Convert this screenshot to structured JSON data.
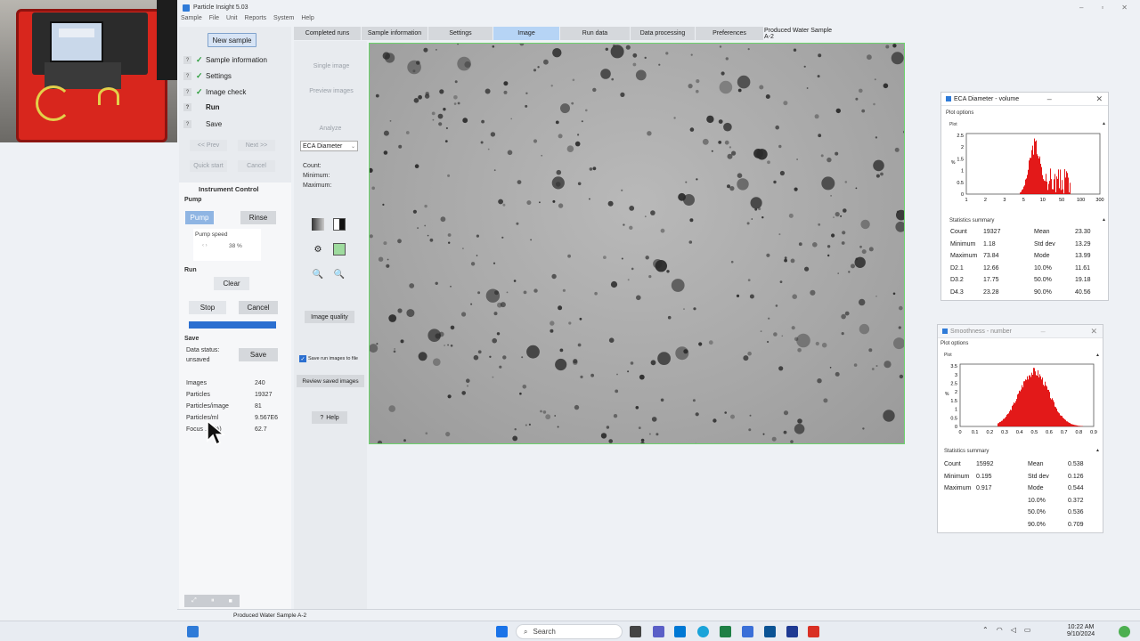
{
  "app": {
    "title": "Particle Insight   5.03",
    "menu": [
      "Sample",
      "File",
      "Unit",
      "Reports",
      "System",
      "Help"
    ],
    "tabs": [
      "Completed runs",
      "Sample information",
      "Settings",
      "Image",
      "Run data",
      "Data processing",
      "Preferences",
      "Produced Water Sample A-2"
    ],
    "active_tab": "Image"
  },
  "left": {
    "new_sample": "New sample",
    "steps": [
      {
        "label": "Sample information",
        "done": true
      },
      {
        "label": "Settings",
        "done": true
      },
      {
        "label": "Image check",
        "done": true
      },
      {
        "label": "Run",
        "done": false
      },
      {
        "label": "Save",
        "done": false
      }
    ],
    "prev": "<< Prev",
    "next": "Next >>",
    "quick_start": "Quick start",
    "cancel": "Cancel"
  },
  "instrument": {
    "title": "Instrument Control",
    "pump_section": "Pump",
    "pump_btn": "Pump",
    "rinse_btn": "Rinse",
    "pump_speed_label": "Pump speed",
    "pump_speed_value": "38 %",
    "run_section": "Run",
    "clear_btn": "Clear",
    "stop_btn": "Stop",
    "cancel_btn": "Cancel",
    "progress": 1.0,
    "save_section": "Save",
    "data_status_label": "Data status:",
    "data_status_value": "unsaved",
    "save_btn": "Save",
    "stats": [
      {
        "label": "Images",
        "value": "240"
      },
      {
        "label": "Particles",
        "value": "19327"
      },
      {
        "label": "Particles/image",
        "value": "81"
      },
      {
        "label": "Particles/ml",
        "value": "9.567E6"
      },
      {
        "label": "Focus ... (%)",
        "value": "62.7"
      }
    ]
  },
  "middle": {
    "single_image": "Single image",
    "preview_images": "Preview images",
    "analyze": "Analyze",
    "dropdown": "ECA Diameter",
    "count_label": "Count:",
    "min_label": "Minimum:",
    "max_label": "Maximum:",
    "image_quality": "Image quality",
    "save_run_images": "Save run images to file",
    "review_saved": "Review saved images",
    "help": "Help"
  },
  "plot1": {
    "title": "ECA Diameter - volume",
    "plot_options": "Plot options",
    "plot_label": "Plot",
    "stats_title": "Statistics summary",
    "rows": [
      [
        "Count",
        "19327",
        "Mean",
        "23.30"
      ],
      [
        "Minimum",
        "1.18",
        "Std dev",
        "13.29"
      ],
      [
        "Maximum",
        "73.84",
        "Mode",
        "13.99"
      ],
      [
        "D2.1",
        "12.66",
        "10.0%",
        "11.61"
      ],
      [
        "D3.2",
        "17.75",
        "50.0%",
        "19.18"
      ],
      [
        "D4.3",
        "23.28",
        "90.0%",
        "40.56"
      ]
    ],
    "chart_data": {
      "type": "bar",
      "x_ticks": [
        "1",
        "2",
        "3",
        "5",
        "10",
        "50",
        "100",
        "300"
      ],
      "y_ticks": [
        "0",
        "0.5",
        "1",
        "1.5",
        "2",
        "2.5"
      ],
      "ylabel": "%",
      "ylim": [
        0,
        2.7
      ]
    }
  },
  "plot2": {
    "title": "Smoothness - number",
    "plot_options": "Plot options",
    "plot_label": "Plot",
    "stats_title": "Statistics summary",
    "rows": [
      [
        "Count",
        "15992",
        "Mean",
        "0.538"
      ],
      [
        "Minimum",
        "0.195",
        "Std dev",
        "0.126"
      ],
      [
        "Maximum",
        "0.917",
        "Mode",
        "0.544"
      ],
      [
        "",
        "",
        "10.0%",
        "0.372"
      ],
      [
        "",
        "",
        "50.0%",
        "0.536"
      ],
      [
        "",
        "",
        "90.0%",
        "0.709"
      ]
    ],
    "chart_data": {
      "type": "bar",
      "x_ticks": [
        "0",
        "0.1",
        "0.2",
        "0.3",
        "0.4",
        "0.5",
        "0.6",
        "0.7",
        "0.8",
        "0.9"
      ],
      "y_ticks": [
        "0",
        "0.5",
        "1",
        "1.5",
        "2",
        "2.5",
        "3",
        "3.5"
      ],
      "ylabel": "%",
      "ylim": [
        0,
        3.6
      ]
    }
  },
  "statusbar": {
    "sample": "Produced Water Sample A-2"
  },
  "taskbar": {
    "search": "Search",
    "time": "10:22 AM",
    "date": "9/10/2024"
  },
  "colors": {
    "accent": "#b6d4f5",
    "bar": "#e00000",
    "progress": "#2b6fd0",
    "check": "#2a9d3a"
  }
}
